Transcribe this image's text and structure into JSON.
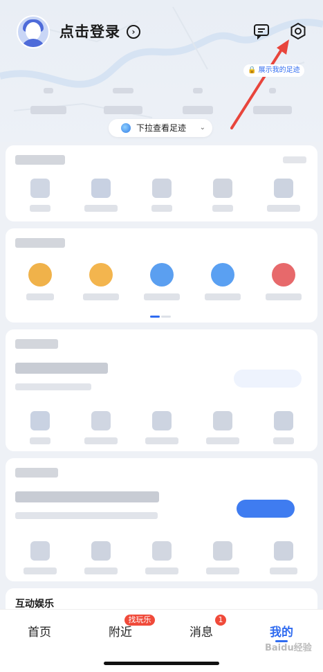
{
  "header": {
    "login_label": "点击登录",
    "footprint_btn": "展示我的足迹",
    "pull_down_label": "下拉查看足迹"
  },
  "section_entertainment": {
    "title": "互动娱乐"
  },
  "tabbar": {
    "tabs": [
      {
        "label": "首页"
      },
      {
        "label": "附近"
      },
      {
        "label": "消息"
      },
      {
        "label": "我的"
      }
    ],
    "nearby_badge": "找玩乐",
    "message_badge": "1",
    "active_color": "#2f6bf0"
  },
  "watermark": "Baidu经验",
  "colors": {
    "accent": "#2f6bf0",
    "badge": "#f04a3a",
    "arrow": "#e8453c"
  },
  "icons": {
    "settings": "gear-icon",
    "messages": "message-icon",
    "chevron": "chevron-right-icon"
  }
}
